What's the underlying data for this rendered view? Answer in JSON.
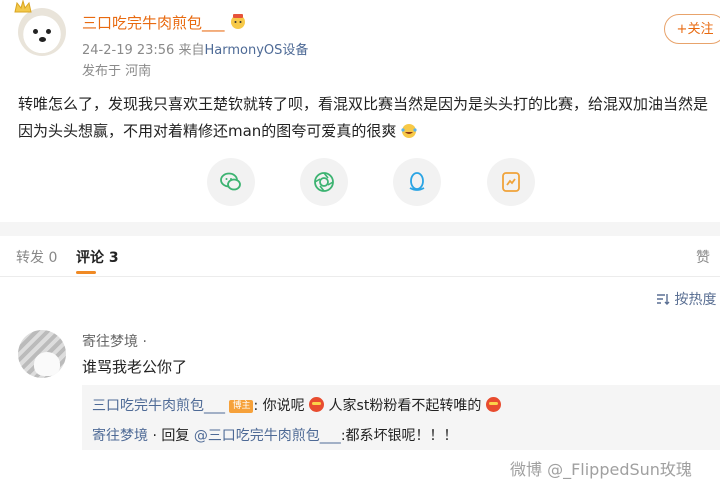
{
  "post": {
    "username": "三口吃完牛肉煎包___",
    "timestamp": "24-2-19 23:56",
    "source_prefix": "来自",
    "source": "HarmonyOS设备",
    "location": "发布于 河南",
    "follow_label": "+关注",
    "text": "转唯怎么了，发现我只喜欢王楚钦就转了呗，看混双比赛当然是因为是头头打的比赛，给混双加油当然是因为头头想赢，不用对着精修还man的图夸可爱真的很爽",
    "share_icons": [
      "wechat-icon",
      "moments-icon",
      "qq-icon",
      "qzone-icon"
    ]
  },
  "tabs": {
    "repost": "转发 0",
    "comment": "评论 3",
    "like": "赞"
  },
  "sort_label": "按热度",
  "comment": {
    "author": "寄往梦境 ·",
    "text": "谁骂我老公你了",
    "replies": [
      {
        "author": "三口吃完牛肉煎包___",
        "tag": "博主",
        "text_a": ": 你说呢",
        "text_b": "人家st粉粉看不起转唯的"
      },
      {
        "author": "寄往梦境",
        "middle": " · 回复 ",
        "mention": "@三口吃完牛肉煎包___",
        "text": ":都系坏银呢！！！"
      }
    ]
  },
  "watermark": "微博 @_FlippedSun玫瑰"
}
